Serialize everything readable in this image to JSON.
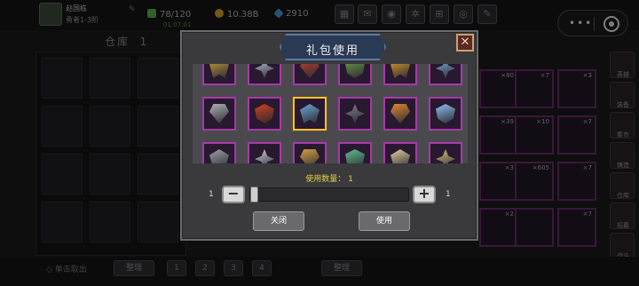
{
  "player": {
    "name": "赵国栋",
    "level": "勇者1-3阶",
    "energy": "78/120",
    "energy_sub": "01:07:01",
    "gold": "10.38B",
    "gems": "2910"
  },
  "warehouse": {
    "title": "仓库",
    "page": "1",
    "counts": [
      "×80",
      "×7",
      "×3",
      "×7",
      "×39",
      "×10",
      "×7",
      "×3",
      "×605",
      "×7",
      "×2"
    ]
  },
  "side_menu": [
    "英雄",
    "装备",
    "集市",
    "铸造",
    "仓库",
    "招募",
    "战斗"
  ],
  "bottom_bar": {
    "hint": "单击取出",
    "sort_left": "整理",
    "pages": [
      "1",
      "2",
      "3",
      "4"
    ],
    "sort_right": "整理"
  },
  "dialog": {
    "title": "礼包使用",
    "close_glyph": "✕",
    "selected_index": 8,
    "items": [
      {
        "icon": "crossed-swords-emblem-icon",
        "color": "#c8a040"
      },
      {
        "icon": "winged-helm-emblem-icon",
        "color": "#c0c8d8"
      },
      {
        "icon": "red-crest-emblem-icon",
        "color": "#c04030"
      },
      {
        "icon": "green-wing-emblem-icon",
        "color": "#70a050"
      },
      {
        "icon": "gold-crown-emblem-icon",
        "color": "#e0a030"
      },
      {
        "icon": "blue-crystal-emblem-icon",
        "color": "#80b0e0"
      },
      {
        "icon": "silver-skull-emblem-icon",
        "color": "#b0b0b8"
      },
      {
        "icon": "red-star-emblem-icon",
        "color": "#d04020"
      },
      {
        "icon": "blue-gold-cross-emblem-icon",
        "color": "#70a8d8"
      },
      {
        "icon": "dark-armor-emblem-icon",
        "color": "#808090"
      },
      {
        "icon": "orange-sun-emblem-icon",
        "color": "#e08830"
      },
      {
        "icon": "ice-blade-emblem-icon",
        "color": "#90c0f0"
      },
      {
        "icon": "grey-wolf-emblem-icon",
        "color": "#a0a0a8"
      },
      {
        "icon": "white-wing-emblem-icon",
        "color": "#d0d0d8"
      },
      {
        "icon": "gold-horn-emblem-icon",
        "color": "#d0a040"
      },
      {
        "icon": "jade-wing-emblem-icon",
        "color": "#60c090"
      },
      {
        "icon": "cream-angel-emblem-icon",
        "color": "#e0d0a0"
      },
      {
        "icon": "gold-spike-emblem-icon",
        "color": "#d8c080"
      }
    ],
    "quantity_label": "使用数量：  1",
    "min": "1",
    "max": "1",
    "quantity": 1,
    "fraction": 0,
    "minus_glyph": "−",
    "plus_glyph": "+",
    "close_label": "关闭",
    "use_label": "使用"
  },
  "colors": {
    "item_border": "#a838a8",
    "selected_border": "#f0c040",
    "quantity_text": "#e8d040"
  }
}
